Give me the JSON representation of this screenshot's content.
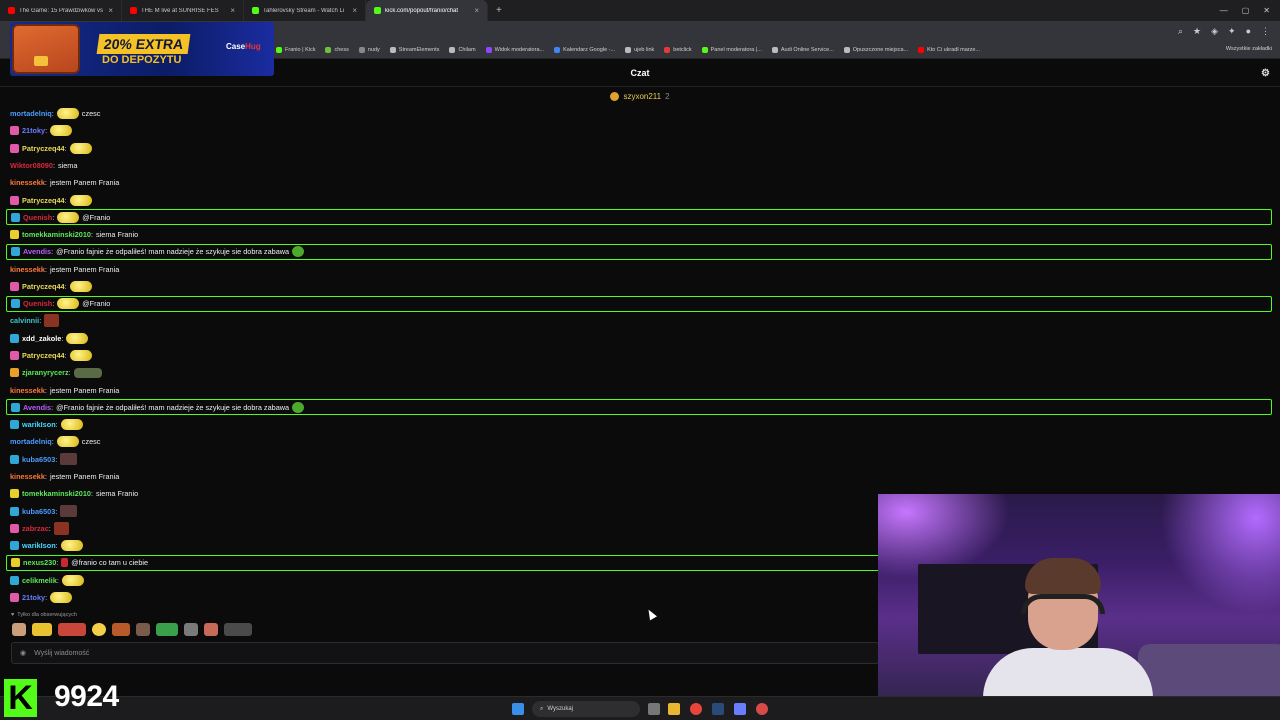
{
  "browser": {
    "tabs": [
      {
        "label": "The Game: 15 Prawdziwków vs",
        "color": "#ff0000",
        "active": false
      },
      {
        "label": "THE M live at SUNRISE FES",
        "color": "#ff0000",
        "active": false
      },
      {
        "label": "Tahlerovsky Stream - Watch Li",
        "color": "#53fc18",
        "active": false
      },
      {
        "label": "kick.com/popout/franio/chat",
        "color": "#53fc18",
        "active": true
      }
    ],
    "new_tab": "+",
    "bookmarks": [
      {
        "label": "Franio | Kick",
        "color": "#53fc18"
      },
      {
        "label": "chess",
        "color": "#6fbf3b"
      },
      {
        "label": "nudy",
        "color": "#888888"
      },
      {
        "label": "StreamElements",
        "color": "#bbbbbb"
      },
      {
        "label": "Chilam",
        "color": "#bbbbbb"
      },
      {
        "label": "Widok moderatora...",
        "color": "#9146ff"
      },
      {
        "label": "Kalendarz Google -...",
        "color": "#4285f4"
      },
      {
        "label": "ujeb link",
        "color": "#bbbbbb"
      },
      {
        "label": "betclick",
        "color": "#e53935"
      },
      {
        "label": "Panel moderatora |...",
        "color": "#53fc18"
      },
      {
        "label": "Audi Online Service...",
        "color": "#bbbbbb"
      },
      {
        "label": "Opuszczone miejsca...",
        "color": "#bbbbbb"
      },
      {
        "label": "Kto Ci ukradł marze...",
        "color": "#ff0000"
      }
    ],
    "all_bookmarks": "Wszystkie zakładki"
  },
  "ad": {
    "line1": "20% EXTRA",
    "line2": "DO DEPOZYTU",
    "brand": "Case",
    "brand_accent": "Hug"
  },
  "chat": {
    "title": "Czat",
    "pinned_user": "szyxon211",
    "pinned_count": "2",
    "messages": [
      {
        "user": "mortadelniq",
        "color": "#4a9cff",
        "text": "czesc",
        "badge": "",
        "emote": "double",
        "hl": false
      },
      {
        "user": "21toky",
        "color": "#6a7cff",
        "text": "",
        "badge": "#e05aa8",
        "emote": "double",
        "hl": false
      },
      {
        "user": "Patryczeq44",
        "color": "#e8d95a",
        "text": "",
        "badge": "#e05aa8",
        "emote": "double",
        "hl": false
      },
      {
        "user": "Wiktor08090",
        "color": "#d8283a",
        "text": "siema",
        "badge": "",
        "emote": "",
        "hl": false
      },
      {
        "user": "kinessekk",
        "color": "#ff7a3a",
        "text": "jestem Panem Frania",
        "badge": "",
        "emote": "",
        "hl": false
      },
      {
        "user": "Patryczeq44",
        "color": "#e8d95a",
        "text": "",
        "badge": "#e05aa8",
        "emote": "double",
        "hl": false
      },
      {
        "user": "Quenish",
        "color": "#d8283a",
        "text": "@Franio",
        "badge": "#2fa8d8",
        "emote": "double",
        "hl": true
      },
      {
        "user": "tomekkaminski2010",
        "color": "#5ee85a",
        "text": "siema Franio",
        "badge": "#e8d028",
        "emote": "",
        "hl": false
      },
      {
        "user": "Avendis",
        "color": "#b85aff",
        "text": "@Franio fajnie że odpaliłeś! mam nadzieje że szykuje sie dobra zabawa",
        "badge": "#2fa8d8",
        "emote": "green",
        "hl": true
      },
      {
        "user": "kinessekk",
        "color": "#ff7a3a",
        "text": "jestem Panem Frania",
        "badge": "",
        "emote": "",
        "hl": false
      },
      {
        "user": "Patryczeq44",
        "color": "#e8d95a",
        "text": "",
        "badge": "#e05aa8",
        "emote": "double",
        "hl": false
      },
      {
        "user": "Quenish",
        "color": "#d8283a",
        "text": "@Franio",
        "badge": "#2fa8d8",
        "emote": "double",
        "hl": true
      },
      {
        "user": "calvinnii",
        "color": "#3ac8c8",
        "text": "",
        "badge": "",
        "emote": "sq",
        "hl": false
      },
      {
        "user": "xdd_zakole",
        "color": "#ffffff",
        "text": "",
        "badge": "#2fa8d8",
        "emote": "double",
        "hl": false
      },
      {
        "user": "Patryczeq44",
        "color": "#e8d95a",
        "text": "",
        "badge": "#e05aa8",
        "emote": "double",
        "hl": false
      },
      {
        "user": "zjaranyrycerz",
        "color": "#5ee85a",
        "text": "",
        "badge": "#e8a028",
        "emote": "tank",
        "hl": false
      },
      {
        "user": "kinessekk",
        "color": "#ff7a3a",
        "text": "jestem Panem Frania",
        "badge": "",
        "emote": "",
        "hl": false
      },
      {
        "user": "Avendis",
        "color": "#b85aff",
        "text": "@Franio fajnie że odpaliłeś! mam nadzieje że szykuje sie dobra zabawa",
        "badge": "#2fa8d8",
        "emote": "green",
        "hl": true
      },
      {
        "user": "warikIson",
        "color": "#4ad8ff",
        "text": "",
        "badge": "#2fa8d8",
        "emote": "double",
        "hl": false
      },
      {
        "user": "mortadelniq",
        "color": "#4a9cff",
        "text": "czesc",
        "badge": "",
        "emote": "double",
        "hl": false
      },
      {
        "user": "kuba6503",
        "color": "#4a9cff",
        "text": "",
        "badge": "#2fa8d8",
        "emote": "face",
        "hl": false
      },
      {
        "user": "kinessekk",
        "color": "#ff7a3a",
        "text": "jestem Panem Frania",
        "badge": "",
        "emote": "",
        "hl": false
      },
      {
        "user": "tomekkaminski2010",
        "color": "#5ee85a",
        "text": "siema Franio",
        "badge": "#e8d028",
        "emote": "",
        "hl": false
      },
      {
        "user": "kuba6503",
        "color": "#4a9cff",
        "text": "",
        "badge": "#2fa8d8",
        "emote": "face",
        "hl": false
      },
      {
        "user": "zabrzac",
        "color": "#d8283a",
        "text": "",
        "badge": "#e05aa8",
        "emote": "sq",
        "hl": false
      },
      {
        "user": "warikIson",
        "color": "#4ad8ff",
        "text": "",
        "badge": "#2fa8d8",
        "emote": "double",
        "hl": false
      },
      {
        "user": "nexus230",
        "color": "#5ee85a",
        "text": "@franio co tam u ciebie",
        "badge": "#e8d028",
        "emote": "red",
        "hl": true
      },
      {
        "user": "celikmelik",
        "color": "#5ee85a",
        "text": "",
        "badge": "#2fa8d8",
        "emote": "double",
        "hl": false
      },
      {
        "user": "21toky",
        "color": "#6a7cff",
        "text": "",
        "badge": "#e05aa8",
        "emote": "double",
        "hl": false
      }
    ],
    "followers_only": "Tylko dla obserwujących",
    "input_placeholder": "Wyślij wiadomość"
  },
  "overlay": {
    "viewer_count": "9924",
    "kick_letter": "K"
  },
  "taskbar": {
    "search_label": "Wyszukaj"
  },
  "accent": "#53fc18"
}
